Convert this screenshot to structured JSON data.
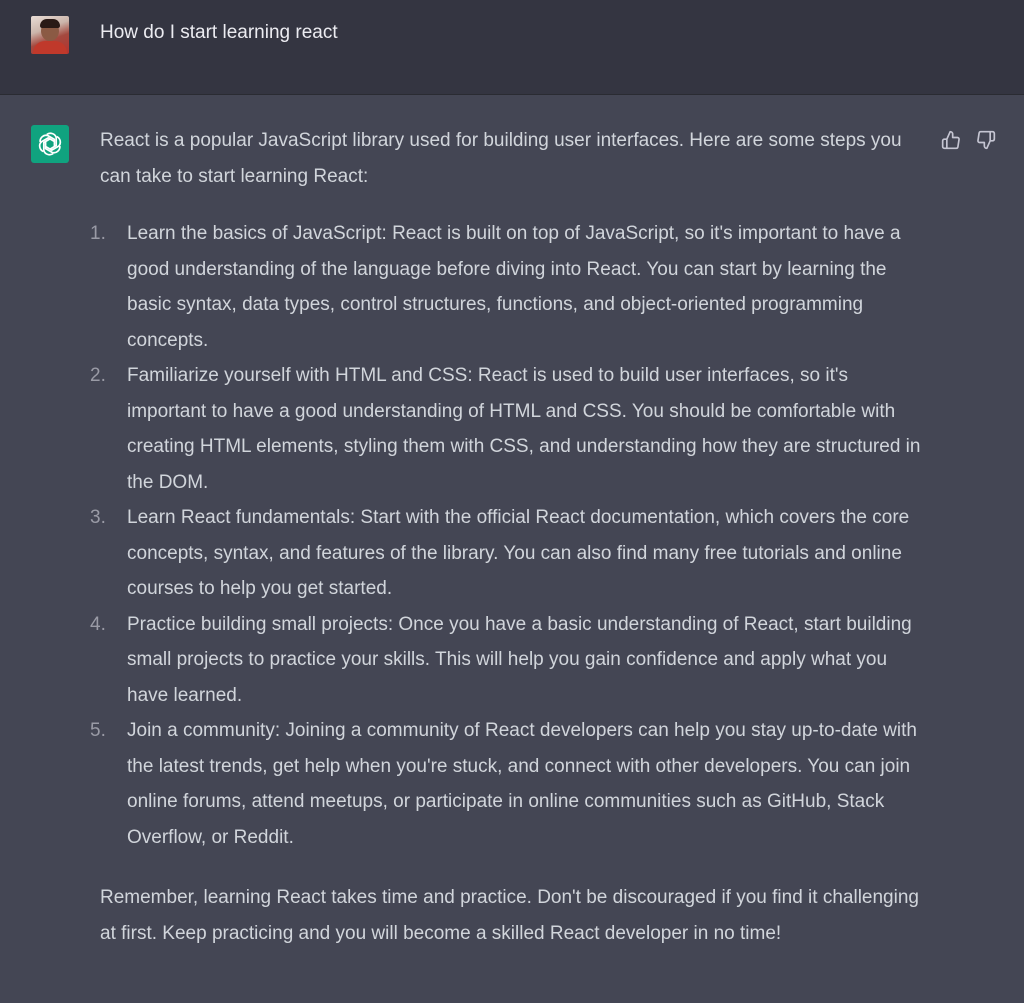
{
  "user_message": {
    "avatar": "user-avatar-photo",
    "text": "How do I start learning react"
  },
  "assistant_message": {
    "avatar_icon": "openai-logo-icon",
    "accent_color": "#10a37f",
    "intro": "React is a popular JavaScript library used for building user interfaces. Here are some steps you can take to start learning React:",
    "steps": [
      {
        "number": "1.",
        "text": "Learn the basics of JavaScript: React is built on top of JavaScript, so it's important to have a good understanding of the language before diving into React. You can start by learning the basic syntax, data types, control structures, functions, and object-oriented programming concepts."
      },
      {
        "number": "2.",
        "text": "Familiarize yourself with HTML and CSS: React is used to build user interfaces, so it's important to have a good understanding of HTML and CSS. You should be comfortable with creating HTML elements, styling them with CSS, and understanding how they are structured in the DOM."
      },
      {
        "number": "3.",
        "text": "Learn React fundamentals: Start with the official React documentation, which covers the core concepts, syntax, and features of the library. You can also find many free tutorials and online courses to help you get started."
      },
      {
        "number": "4.",
        "text": "Practice building small projects: Once you have a basic understanding of React, start building small projects to practice your skills. This will help you gain confidence and apply what you have learned."
      },
      {
        "number": "5.",
        "text": "Join a community: Joining a community of React developers can help you stay up-to-date with the latest trends, get help when you're stuck, and connect with other developers. You can join online forums, attend meetups, or participate in online communities such as GitHub, Stack Overflow, or Reddit."
      }
    ],
    "outro": "Remember, learning React takes time and practice. Don't be discouraged if you find it challenging at first. Keep practicing and you will become a skilled React developer in no time!",
    "feedback": {
      "up_icon": "thumbs-up-icon",
      "down_icon": "thumbs-down-icon"
    }
  }
}
